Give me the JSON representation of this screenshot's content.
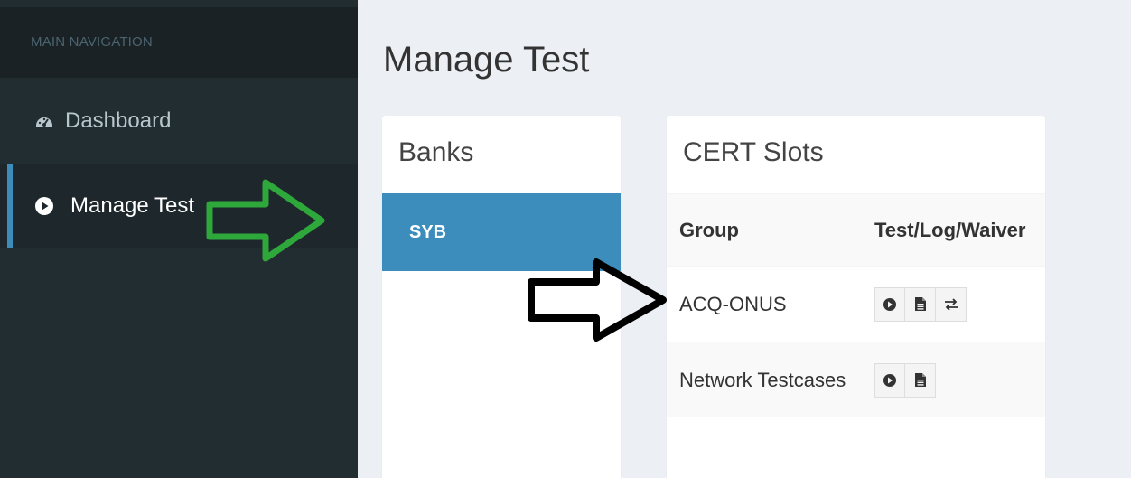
{
  "sidebar": {
    "header": "MAIN NAVIGATION",
    "items": [
      {
        "label": "Dashboard",
        "icon": "dashboard-icon"
      },
      {
        "label": "Manage Test",
        "icon": "play-circle-icon",
        "active": true
      }
    ]
  },
  "page": {
    "title": "Manage Test"
  },
  "banks": {
    "title": "Banks",
    "items": [
      {
        "label": "SYB",
        "selected": true
      }
    ]
  },
  "cert": {
    "title": "CERT Slots",
    "columns": [
      "Group",
      "Test/Log/Waiver"
    ],
    "rows": [
      {
        "group": "ACQ-ONUS",
        "actions": [
          "play-icon",
          "file-icon",
          "exchange-icon"
        ]
      },
      {
        "group": "Network Testcases",
        "actions": [
          "play-icon",
          "file-icon"
        ]
      }
    ]
  },
  "colors": {
    "sidebar_bg": "#222d32",
    "accent": "#3c8dbc",
    "annotation_green": "#2ea83a",
    "annotation_black": "#000000"
  }
}
